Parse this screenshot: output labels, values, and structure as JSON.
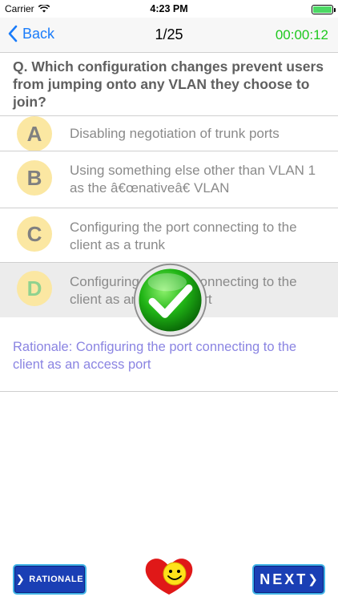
{
  "status_bar": {
    "carrier": "Carrier",
    "time": "4:23 PM"
  },
  "nav": {
    "back_label": "Back",
    "counter": "1/25",
    "timer": "00:00:12"
  },
  "question": {
    "text": "Q.  Which  configuration changes prevent users from jumping onto any VLAN they choose to join?"
  },
  "options": [
    {
      "letter": "A",
      "text": "Disabling negotiation of trunk ports"
    },
    {
      "letter": "B",
      "text": "Using something else other than VLAN 1 as the â€œnativeâ€ VLAN"
    },
    {
      "letter": "C",
      "text": "Configuring the port connecting to the client as a trunk"
    },
    {
      "letter": "D",
      "text": "Configuring the port connecting to the client as an access port",
      "selected": true,
      "correct": true
    }
  ],
  "rationale": {
    "text": "Rationale: Configuring the port connecting to the client as an access port"
  },
  "buttons": {
    "rationale_label": "RATIONALE",
    "next_label": "NEXT"
  },
  "icons": {
    "wifi": "wifi-icon",
    "check": "check-icon",
    "smiley": "smiley-heart-icon",
    "back": "chevron-left-icon"
  },
  "colors": {
    "accent": "#1a7cfa",
    "timer": "#1ec81e",
    "badge": "#fbe7a2",
    "rationale": "#8a84e2",
    "button": "#1a3fb5"
  }
}
